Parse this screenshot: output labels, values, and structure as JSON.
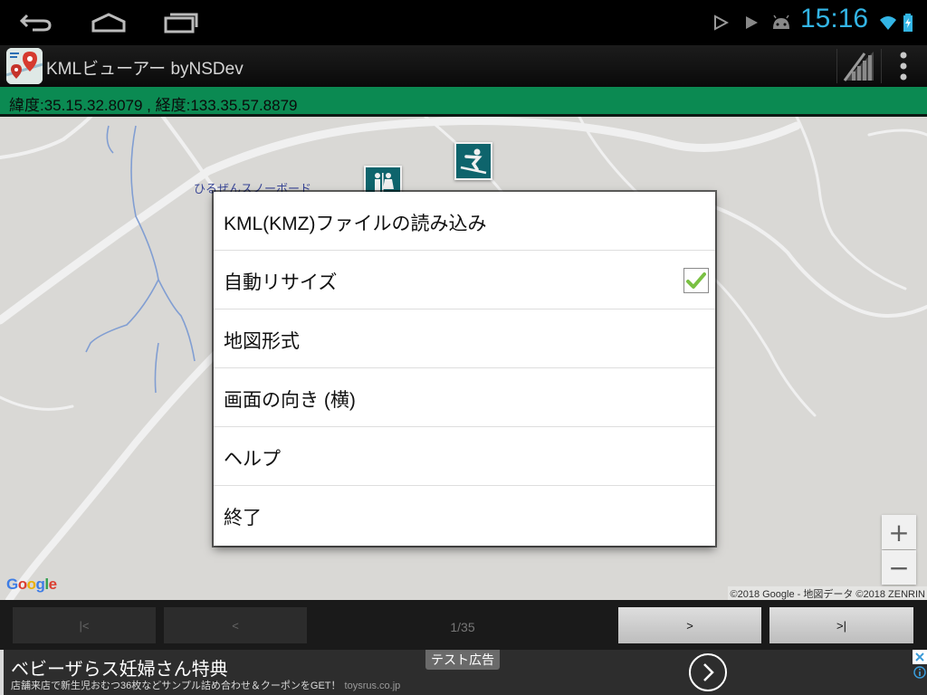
{
  "system_bar": {
    "time": "15:16",
    "icons": {
      "back": "back-arrow-icon",
      "home": "home-icon",
      "recents": "recent-apps-icon",
      "notif1": "play-store-icon",
      "notif2": "play-store-icon",
      "notif3": "android-icon",
      "wifi": "wifi-icon",
      "battery": "battery-charging-icon"
    }
  },
  "action_bar": {
    "title": "KMLビューアー byNSDev",
    "icons": {
      "app": "map-pin-app-icon",
      "signal": "signal-off-icon",
      "overflow": "overflow-menu-icon"
    }
  },
  "coordinates": {
    "text": "緯度:35.15.32.8079 , 経度:133.35.57.8879"
  },
  "map": {
    "poi_label": "ひるぜんスノーボード",
    "logo": {
      "G": "G",
      "o1": "o",
      "o2": "o",
      "g": "g",
      "l": "l",
      "e": "e"
    },
    "attribution": "©2018 Google - 地図データ ©2018 ZENRIN",
    "zoom_in": "+",
    "zoom_out": "−",
    "colors": {
      "background": "#e7e6e3",
      "road": "#ffffff",
      "river": "#8aa8e0",
      "marker": "#0f6b73"
    }
  },
  "menu": {
    "items": [
      {
        "label": "KML(KMZ)ファイルの読み込み"
      },
      {
        "label": "自動リサイズ",
        "checked": true
      },
      {
        "label": "地図形式"
      },
      {
        "label": "画面の向き (横)"
      },
      {
        "label": "ヘルプ"
      },
      {
        "label": "終了"
      }
    ]
  },
  "controls": {
    "first": "|<",
    "prev": "<",
    "page": "1/35",
    "next": ">",
    "last": ">|"
  },
  "ad": {
    "badge": "テスト広告",
    "title": "ベビーザらス妊婦さん特典",
    "subtitle": "店舗来店で新生児おむつ36枚などサンプル詰め合わせ＆クーポンをGET！",
    "domain": "toysrus.co.jp"
  }
}
